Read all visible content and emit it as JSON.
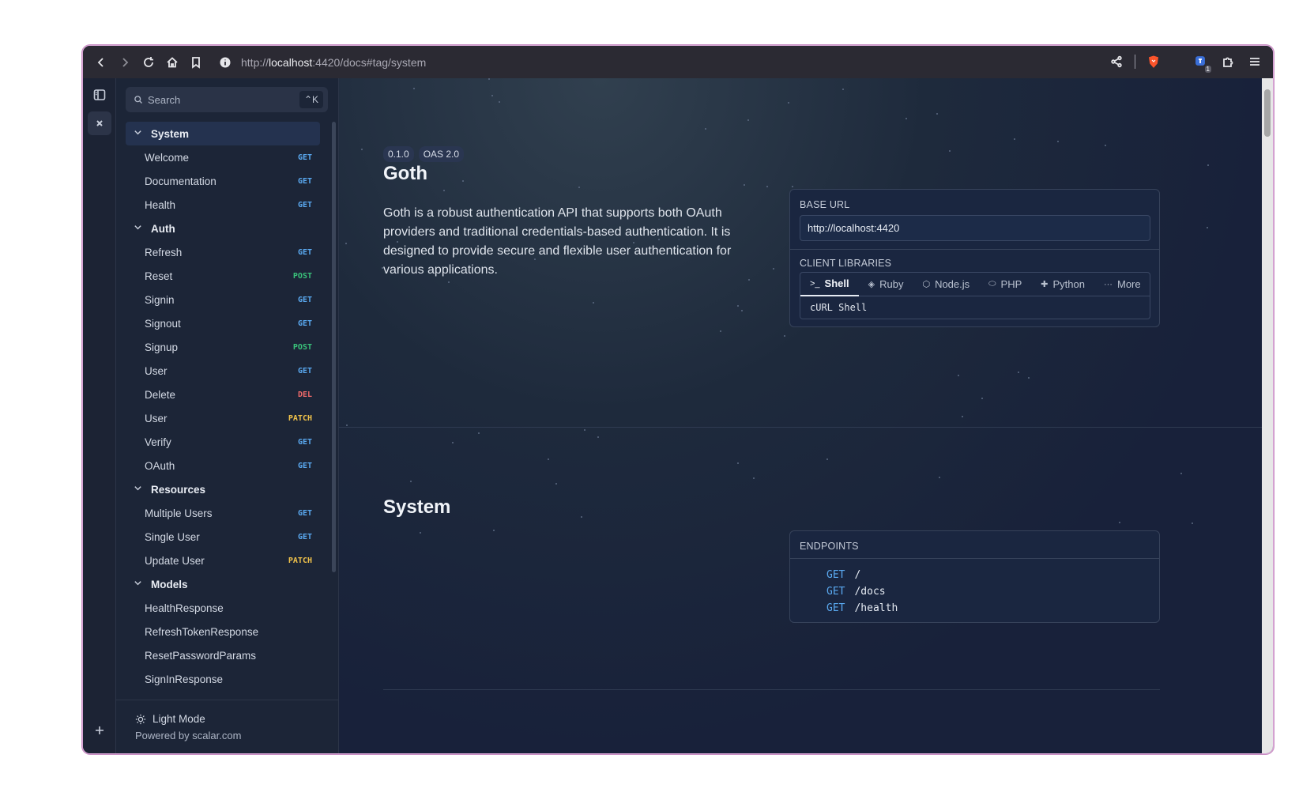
{
  "browser": {
    "url_scheme": "http://",
    "url_host": "localhost",
    "url_rest": ":4420/docs#tag/system",
    "extension_badge": "1"
  },
  "sidebar": {
    "search_placeholder": "Search",
    "search_shortcut": "⌃K",
    "groups": [
      {
        "label": "System",
        "items": [
          {
            "label": "Welcome",
            "method": "GET"
          },
          {
            "label": "Documentation",
            "method": "GET"
          },
          {
            "label": "Health",
            "method": "GET"
          }
        ]
      },
      {
        "label": "Auth",
        "items": [
          {
            "label": "Refresh",
            "method": "GET"
          },
          {
            "label": "Reset",
            "method": "POST"
          },
          {
            "label": "Signin",
            "method": "GET"
          },
          {
            "label": "Signout",
            "method": "GET"
          },
          {
            "label": "Signup",
            "method": "POST"
          },
          {
            "label": "User",
            "method": "GET"
          },
          {
            "label": "Delete",
            "method": "DEL"
          },
          {
            "label": "User",
            "method": "PATCH"
          },
          {
            "label": "Verify",
            "method": "GET"
          },
          {
            "label": "OAuth",
            "method": "GET"
          }
        ]
      },
      {
        "label": "Resources",
        "items": [
          {
            "label": "Multiple Users",
            "method": "GET"
          },
          {
            "label": "Single User",
            "method": "GET"
          },
          {
            "label": "Update User",
            "method": "PATCH"
          }
        ]
      },
      {
        "label": "Models",
        "items": [
          {
            "label": "HealthResponse",
            "method": ""
          },
          {
            "label": "RefreshTokenResponse",
            "method": ""
          },
          {
            "label": "ResetPasswordParams",
            "method": ""
          },
          {
            "label": "SignInResponse",
            "method": ""
          }
        ]
      }
    ],
    "light_mode_label": "Light Mode",
    "powered_by": "Powered by scalar.com"
  },
  "main": {
    "version_badge": "0.1.0",
    "oas_badge": "OAS 2.0",
    "title": "Goth",
    "description": "Goth is a robust authentication API that supports both OAuth providers and traditional credentials-based authentication. It is designed to provide secure and flexible user authentication for various applications.",
    "base_url_label": "BASE URL",
    "base_url_value": "http://localhost:4420",
    "client_libraries_label": "CLIENT LIBRARIES",
    "client_tabs": [
      {
        "label": "Shell",
        "icon": ">_"
      },
      {
        "label": "Ruby",
        "icon": "◈"
      },
      {
        "label": "Node.js",
        "icon": "⬡"
      },
      {
        "label": "PHP",
        "icon": "⬭"
      },
      {
        "label": "Python",
        "icon": "✚"
      },
      {
        "label": "More",
        "icon": "···"
      }
    ],
    "client_code": "cURL Shell",
    "system_title": "System",
    "endpoints_label": "ENDPOINTS",
    "endpoints": [
      {
        "method": "GET",
        "path": "/"
      },
      {
        "method": "GET",
        "path": "/docs"
      },
      {
        "method": "GET",
        "path": "/health"
      }
    ]
  },
  "colors": {
    "get": "#5aa9f0",
    "post": "#39c27a",
    "delete": "#ef6a6a",
    "patch": "#f0c24a"
  }
}
